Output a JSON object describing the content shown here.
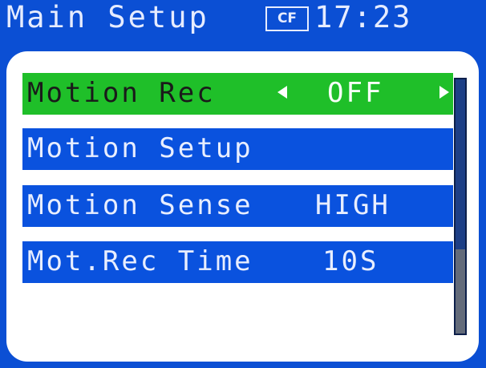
{
  "header": {
    "title": "Main Setup",
    "storage_badge": "CF",
    "clock": "17:23"
  },
  "menu": {
    "items": [
      {
        "label": "Motion Rec",
        "value": "OFF",
        "selected": true,
        "has_arrows": true
      },
      {
        "label": "Motion Setup",
        "value": "",
        "selected": false,
        "has_arrows": false
      },
      {
        "label": "Motion Sense",
        "value": "HIGH",
        "selected": false,
        "has_arrows": false
      },
      {
        "label": "Mot.Rec Time",
        "value": "10S",
        "selected": false,
        "has_arrows": false
      }
    ]
  },
  "scrollbar": {
    "thumb_start_fraction": 0.67,
    "thumb_end_fraction": 1.0
  },
  "colors": {
    "background": "#0b4fd4",
    "row": "#0a52de",
    "selected_row": "#1fbf29",
    "panel": "#ffffff",
    "text": "#e8eeff"
  },
  "icons": {
    "prev": "left-triangle-icon",
    "next": "right-triangle-icon"
  }
}
